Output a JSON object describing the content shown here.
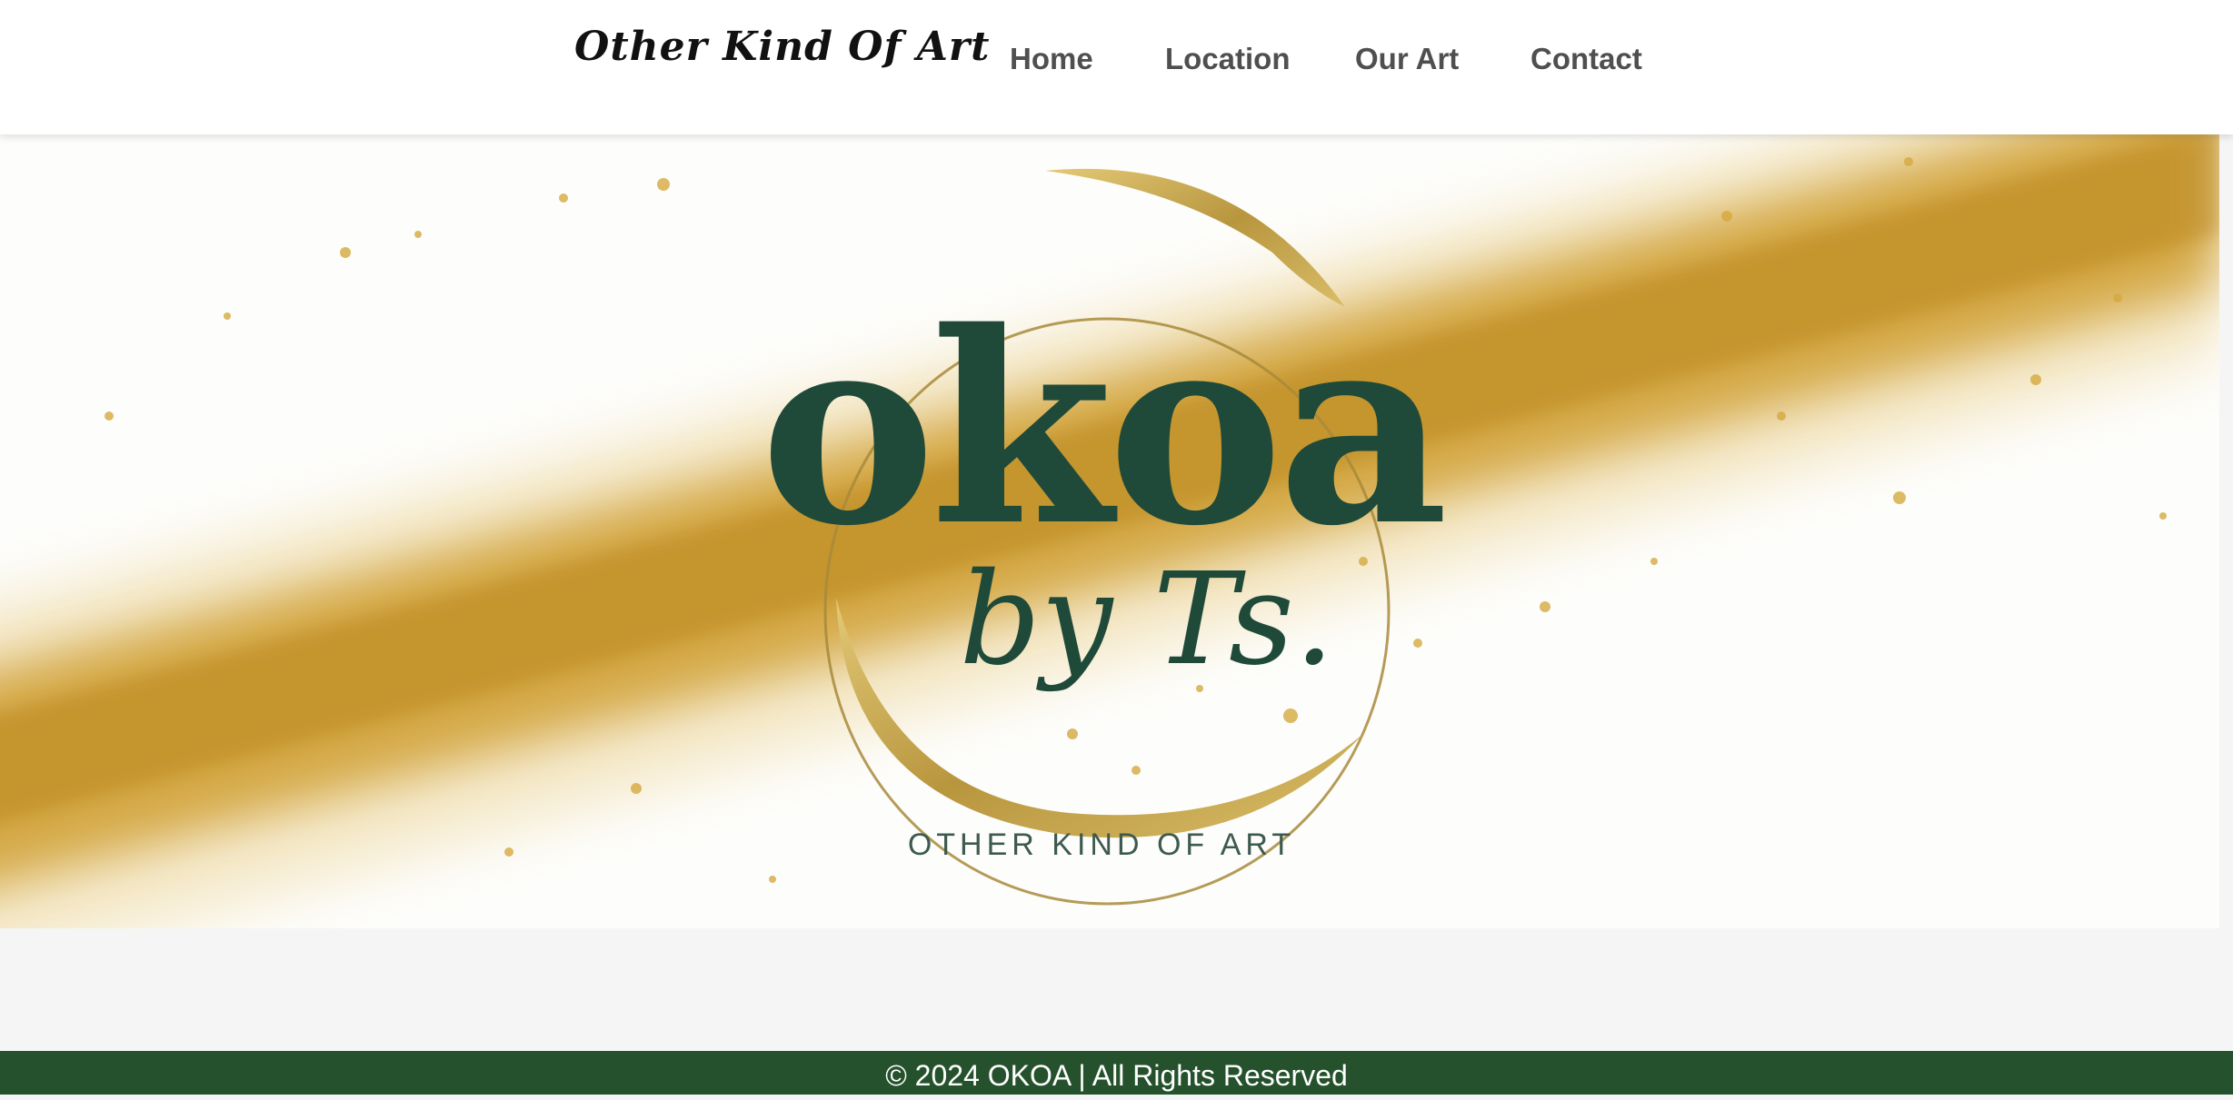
{
  "header": {
    "site_title": "Other Kind Of Art",
    "nav": [
      {
        "label": "Home"
      },
      {
        "label": "Location"
      },
      {
        "label": "Our Art"
      },
      {
        "label": "Contact"
      }
    ]
  },
  "hero": {
    "logo_main": "okoa",
    "logo_by": "by Ts.",
    "tagline": "OTHER KIND OF ART"
  },
  "footer": {
    "text": "© 2024 OKOA | All Rights Reserved"
  },
  "colors": {
    "brand_green": "#1f4a3a",
    "gold": "#c9a03a",
    "footer_bg": "#25522d",
    "nav_text": "#4f4f4f"
  }
}
